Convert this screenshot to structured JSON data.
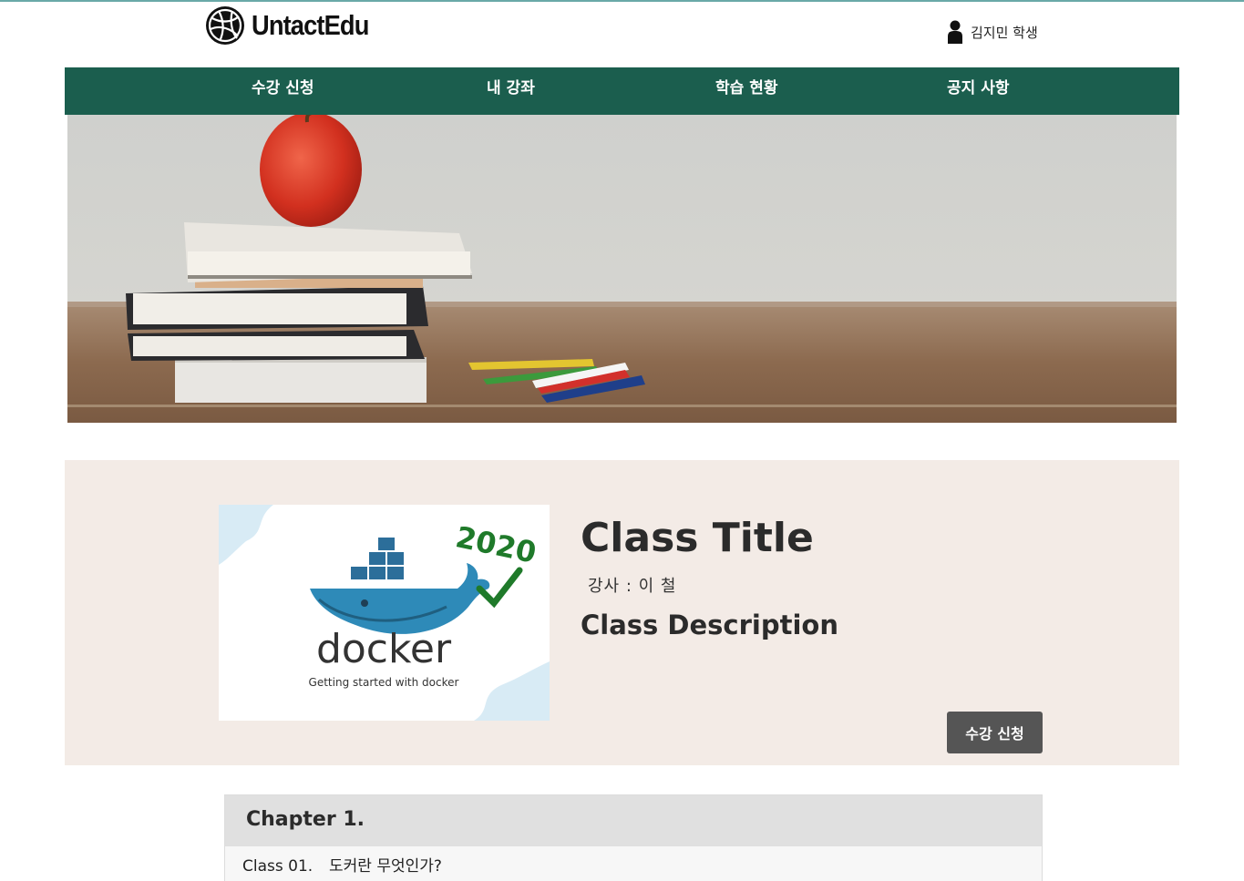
{
  "header": {
    "logo_text": "UntactEdu",
    "logo_icon": "basketball-icon",
    "user_icon": "user-icon",
    "user_name": "김지민 학생"
  },
  "nav": {
    "items": [
      {
        "label": "수강 신청"
      },
      {
        "label": "내 강좌"
      },
      {
        "label": "학습 현황"
      },
      {
        "label": "공지 사항"
      }
    ]
  },
  "course": {
    "thumbnail": {
      "year": "2020",
      "brand": "docker",
      "tagline": "Getting started with docker"
    },
    "title": "Class Title",
    "teacher": "강사 : 이 철",
    "description": "Class Description",
    "enroll_label": "수강 신청"
  },
  "chapters": [
    {
      "title": "Chapter 1.",
      "lessons": [
        {
          "number": "Class 01.",
          "title": "도커란 무엇인가?"
        }
      ]
    }
  ],
  "colors": {
    "nav_bg": "#1b5e4e",
    "panel_bg": "#f3ebe6",
    "button_bg": "#555555"
  }
}
